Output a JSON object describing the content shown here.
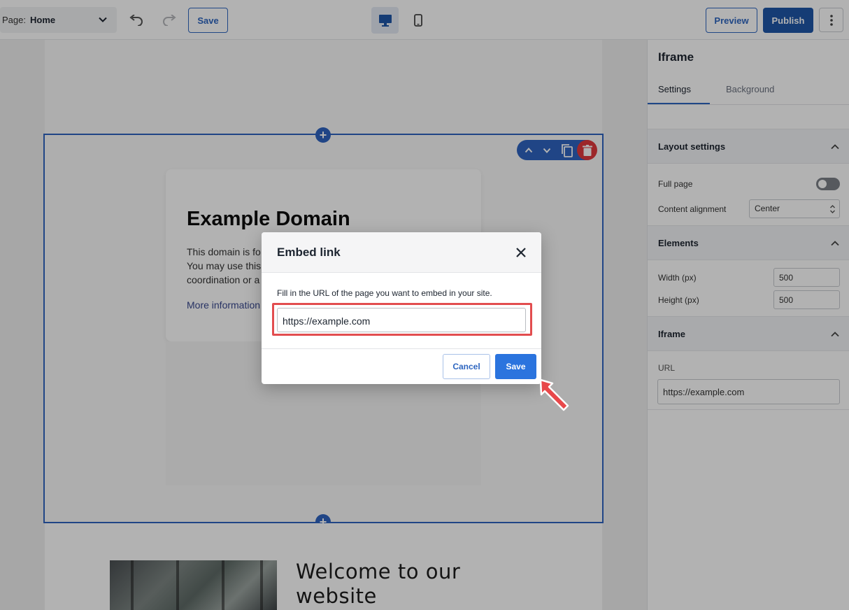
{
  "toolbar": {
    "page_label": "Page:",
    "page_value": "Home",
    "save_label": "Save",
    "preview_label": "Preview",
    "publish_label": "Publish"
  },
  "canvas": {
    "example_title": "Example Domain",
    "example_line1": "This domain is fo",
    "example_line2": "You may use this",
    "example_line3": "coordination or a",
    "example_more": "More information",
    "welcome": "Welcome to our website",
    "add_symbol": "+"
  },
  "panel": {
    "title": "Iframe",
    "tabs": [
      "Settings",
      "Background"
    ],
    "layout_settings": {
      "heading": "Layout settings",
      "full_page_label": "Full page",
      "full_page_on": false,
      "content_alignment_label": "Content alignment",
      "content_alignment_value": "Center"
    },
    "elements": {
      "heading": "Elements",
      "width_label": "Width (px)",
      "width_value": "500",
      "height_label": "Height (px)",
      "height_value": "500"
    },
    "iframe": {
      "heading": "Iframe",
      "url_label": "URL",
      "url_value": "https://example.com"
    }
  },
  "modal": {
    "title": "Embed link",
    "description": "Fill in the URL of the page you want to embed in your site.",
    "url_value": "https://example.com",
    "cancel_label": "Cancel",
    "save_label": "Save"
  },
  "colors": {
    "accent": "#2e66c0",
    "publish": "#1f56a8",
    "highlight": "#e24d4f",
    "delete": "#e0383d"
  },
  "icons": [
    "chevron-down-icon",
    "undo-icon",
    "redo-icon",
    "desktop-icon",
    "mobile-icon",
    "more-vertical-icon",
    "chevron-up-icon",
    "copy-icon",
    "trash-icon",
    "close-icon",
    "plus-icon",
    "pointer-arrow-icon"
  ]
}
